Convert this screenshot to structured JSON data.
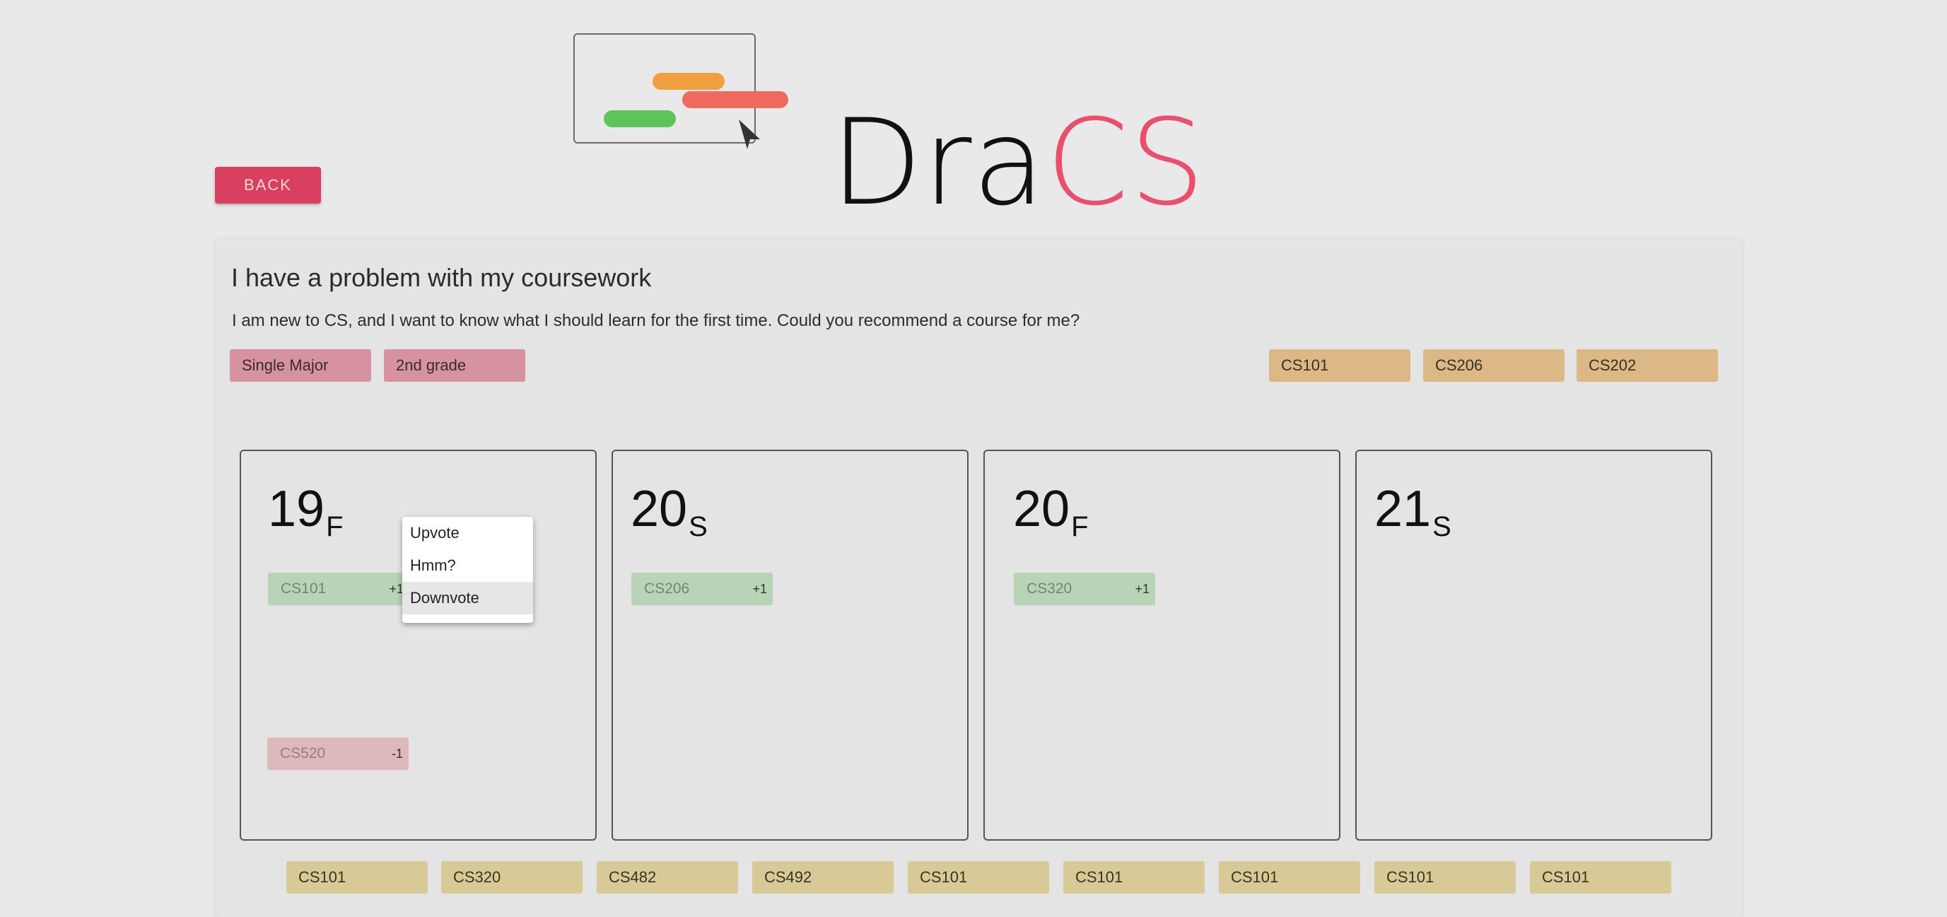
{
  "brand": {
    "prefix": "Dra",
    "accent": "CS"
  },
  "nav": {
    "back_label": "BACK"
  },
  "question": {
    "title": "I have a problem with my coursework",
    "body": "I am new to CS, and I want to know what I should learn for the first time. Could you recommend a course for me?"
  },
  "user_tags": [
    "Single Major",
    "2nd grade"
  ],
  "taken_courses": [
    "CS101",
    "CS206",
    "CS202"
  ],
  "semesters": [
    {
      "year": "19",
      "term": "F",
      "courses": [
        {
          "code": "CS101",
          "score": "+1",
          "vote": "up"
        },
        {
          "code": "CS520",
          "score": "-1",
          "vote": "down"
        }
      ]
    },
    {
      "year": "20",
      "term": "S",
      "courses": [
        {
          "code": "CS206",
          "score": "+1",
          "vote": "up"
        }
      ]
    },
    {
      "year": "20",
      "term": "F",
      "courses": [
        {
          "code": "CS320",
          "score": "+1",
          "vote": "up"
        }
      ]
    },
    {
      "year": "21",
      "term": "S",
      "courses": []
    }
  ],
  "context_menu": {
    "items": [
      "Upvote",
      "Hmm?",
      "Downvote"
    ],
    "highlighted": "Downvote"
  },
  "course_pool": [
    "CS101",
    "CS320",
    "CS482",
    "CS492",
    "CS101",
    "CS101",
    "CS101",
    "CS101",
    "CS101"
  ],
  "colors": {
    "accent": "#e8506e",
    "back_button": "#d93f5f",
    "tag_pink": "#d6939f",
    "tag_orange": "#dbb886",
    "tag_yellow": "#d8ca96",
    "upvoted": "#b7d4b6",
    "downvoted": "#deb9bc",
    "logo_orange": "#f0a040",
    "logo_red": "#ee6a5c",
    "logo_green": "#5cc45a"
  }
}
